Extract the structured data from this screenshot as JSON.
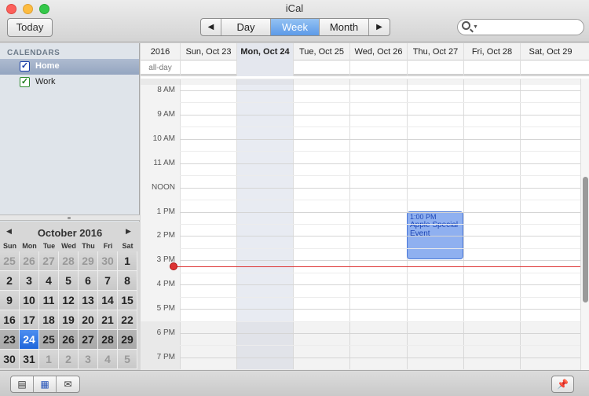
{
  "window": {
    "title": "iCal"
  },
  "toolbar": {
    "today_label": "Today",
    "views": {
      "prev": "◀",
      "day": "Day",
      "week": "Week",
      "month": "Month",
      "next": "▶"
    },
    "search_placeholder": ""
  },
  "sidebar": {
    "header": "CALENDARS",
    "calendars": [
      {
        "label": "Home",
        "checked": true,
        "color": "#1a3fa8"
      },
      {
        "label": "Work",
        "checked": true,
        "color": "#2b8a2b"
      }
    ]
  },
  "minical": {
    "title": "October 2016",
    "prev": "◀",
    "next": "▶",
    "dows": [
      "Sun",
      "Mon",
      "Tue",
      "Wed",
      "Thu",
      "Fri",
      "Sat"
    ],
    "weeks": [
      [
        "25",
        "26",
        "27",
        "28",
        "29",
        "30",
        "1"
      ],
      [
        "2",
        "3",
        "4",
        "5",
        "6",
        "7",
        "8"
      ],
      [
        "9",
        "10",
        "11",
        "12",
        "13",
        "14",
        "15"
      ],
      [
        "16",
        "17",
        "18",
        "19",
        "20",
        "21",
        "22"
      ],
      [
        "23",
        "24",
        "25",
        "26",
        "27",
        "28",
        "29"
      ],
      [
        "30",
        "31",
        "1",
        "2",
        "3",
        "4",
        "5"
      ]
    ]
  },
  "week": {
    "year": "2016",
    "allday_label": "all-day",
    "days": [
      "Sun, Oct 23",
      "Mon, Oct 24",
      "Tue, Oct 25",
      "Wed, Oct 26",
      "Thu, Oct 27",
      "Fri, Oct 28",
      "Sat, Oct 29"
    ],
    "hours": [
      "8 AM",
      "9 AM",
      "10 AM",
      "11 AM",
      "NOON",
      "1 PM",
      "2 PM",
      "3 PM",
      "4 PM",
      "5 PM",
      "6 PM",
      "7 PM"
    ]
  },
  "event": {
    "time": "1:00 PM",
    "title": "Apple Special Event",
    "color": "#8fb0f0"
  },
  "bottombar": {
    "buttons": [
      "calendars-toggle",
      "minical-toggle",
      "notifications"
    ],
    "pin": "pin"
  }
}
